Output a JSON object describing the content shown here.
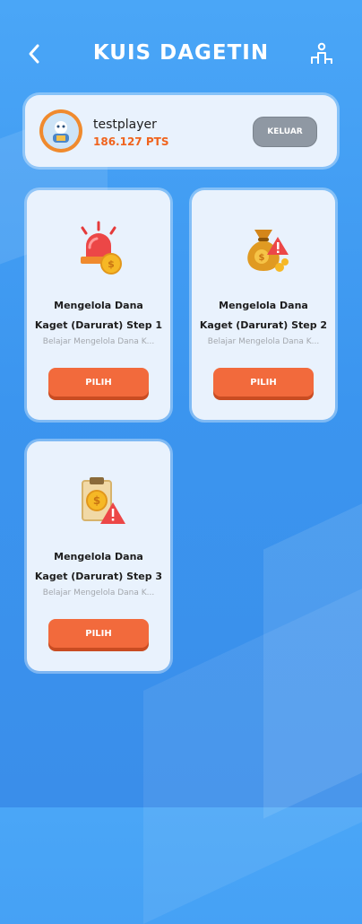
{
  "header": {
    "title": "KUIS DAGETIN",
    "back_icon": "chevron-left-icon",
    "leaderboard_icon": "leaderboard-icon"
  },
  "profile": {
    "username": "testplayer",
    "points": "186.127 PTS",
    "logout_label": "KELUAR"
  },
  "quizzes": [
    {
      "title_line1": "Mengelola Dana",
      "title_line2": "Kaget (Darurat) Step 1",
      "description": "Belajar Mengelola Dana K...",
      "button_label": "PILIH",
      "icon": "siren-coin-icon"
    },
    {
      "title_line1": "Mengelola Dana",
      "title_line2": "Kaget (Darurat) Step 2",
      "description": "Belajar Mengelola Dana K...",
      "button_label": "PILIH",
      "icon": "money-bag-warning-icon"
    },
    {
      "title_line1": "Mengelola Dana",
      "title_line2": "Kaget (Darurat) Step 3",
      "description": "Belajar Mengelola Dana K...",
      "button_label": "PILIH",
      "icon": "clipboard-coin-warning-icon"
    }
  ],
  "colors": {
    "background": "#3b95ef",
    "card": "#e9f2fd",
    "accent": "#f26a3c",
    "points": "#f0631d"
  }
}
